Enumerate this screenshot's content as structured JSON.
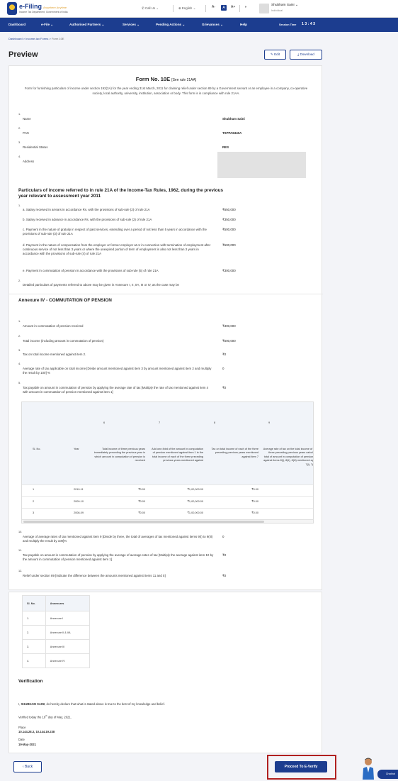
{
  "header": {
    "logo_title": "e-Filing",
    "logo_subtitle": "Anywhere Anytime",
    "logo_tagline": "Income Tax Department, Government of India",
    "call_us": "Call Us",
    "language": "English",
    "a11y_small": "A-",
    "a11y_normal": "A",
    "a11y_large": "A+",
    "contrast": "◑",
    "user_name": "Shubham Saini",
    "user_role": "Individual"
  },
  "nav": {
    "items": [
      "Dashboard",
      "e-File",
      "Authorised Partners",
      "Services",
      "Pending Actions",
      "Grievances",
      "Help"
    ],
    "session_label": "Session Time",
    "session_time": "1 3 : 4 3"
  },
  "breadcrumb": [
    "Dashboard",
    "Income-tax Forms",
    "Form 10E"
  ],
  "page": {
    "title": "Preview",
    "edit_label": "Edit",
    "download_label": "Download"
  },
  "form": {
    "title": "Form No. 10E",
    "rule_ref": "[See rule 21AA]",
    "description": "Form for furnishing particulars of income under section 192(2A) for the year ending 31st March, 2011 for claiming relief under section 89 by a Government servant or an employee in a company, co-operative society, local authority, university, institution, association or body. This form is in compliance with rule 21AA.",
    "personal": [
      {
        "num": "1.",
        "label": "Name",
        "value": "Shubham Saini"
      },
      {
        "num": "2.",
        "label": "PAN",
        "value": "TSPPA6340A"
      },
      {
        "num": "3.",
        "label": "Residential Status",
        "value": "RES"
      },
      {
        "num": "4.",
        "label": "Address",
        "value": ""
      }
    ],
    "particulars_heading": "Particulars of income referred to in rule 21A of the Income-Tax Rules, 1962, during the previous year relevant to assessment year 2011",
    "particulars_num": "1.",
    "particulars": [
      {
        "label": "a. Salary received in arrears in accordance Rs. with the provisions of sub-rule (2) of rule 21A",
        "value": "₹650,000"
      },
      {
        "label": "b. Salary received in advance in accordance Rs. with the provisions of sub-rule (2) of rule 21A",
        "value": "₹350,000"
      },
      {
        "label": "c. Payment in the nature of gratuity in respect of past services, extending over a period of not less than 5 years in accordance with the provisions of sub-rule (3) of rule 21A",
        "value": "₹500,000"
      },
      {
        "label": "d. Payment in the nature of compensation from the employer or former employer at or in connection with termination of employment after continuous service of not less than 3 years or where the unexpired portion of term of employment is also not less than 3 years in accordance with the provisions of sub-rule (4) of rule 21A",
        "value": "₹500,000"
      },
      {
        "label": "e. Payment in commutation of pension in accordance with the provisions of sub-rule (5) of rule 21A",
        "value": "₹300,000"
      }
    ],
    "item2_num": "2.",
    "item2_label": "Detailed particulars of payments referred to above may be given in Annexure I, II, IIA, III or IV, as the case may be"
  },
  "annexure4": {
    "heading": "Annexure IV - COMMUTATION OF PENSION",
    "items": [
      {
        "num": "1.",
        "label": "Amount in commutation of pension received",
        "value": "₹300,000"
      },
      {
        "num": "2.",
        "label": "Total income (including amount in commutation of pension)",
        "value": "₹600,000"
      },
      {
        "num": "3.",
        "label": "Tax on total income mentioned against item 2.",
        "value": "₹0"
      },
      {
        "num": "4.",
        "label": "Average rate of tax applicable on total income [Divide amount mentioned against item 3 by amount mentioned against item 2 and multiply the result by 100] %",
        "value": "0"
      },
      {
        "num": "5.",
        "label": "Tax payable on amount in commutation of pension by applying the average rate of tax [Multiply the rate of tax mentioned against item 4 with amount in commutation of pension mentioned against item 1]",
        "value": "₹0"
      }
    ],
    "table": {
      "col_numbers": [
        "6",
        "7",
        "8",
        "9"
      ],
      "headers": [
        "Sl. No.",
        "Year",
        "Total income of three previous years immediately preceding the previous year in which amount in computation of pension is received",
        "Add one-third of the amount in computation of pension mentioned against item 1 in the total income of each of the three preceding previous years mentioned against",
        "Tax on total income of each of the three preceding previous years mentioned against item 7",
        "Average rate of tax on the total income of each of the three preceding previous years calculated on the total of amount in computation of pension mentioned against items 8(i), 8(ii), 8(iii) mentioned against items 7(i), 7(ii) and 7(iii)"
      ],
      "rows": [
        [
          "1",
          "2010-11",
          "₹0.00",
          "₹1,00,000.00",
          "₹0.00"
        ],
        [
          "2",
          "2009-10",
          "₹0.00",
          "₹1,00,000.00",
          "₹0.00"
        ],
        [
          "3",
          "2008-09",
          "₹0.00",
          "₹1,00,000.00",
          "₹0.00"
        ]
      ]
    },
    "items_after": [
      {
        "num": "10.",
        "label": "Average of average rates of tax mentioned against item 9 [Divide by three, the total of averages of tax mentioned against items 9(i) to 9(iii) and multiply the result by 100]%",
        "value": "0"
      },
      {
        "num": "11.",
        "label": "Tax payable on amount in commutation of pension by applying the average of average rates of tax [Multiply the average against item 10 by the amount in commutation of pension mentioned against item 1]",
        "value": "₹0"
      },
      {
        "num": "12.",
        "label": "Relief under section 89 [Indicate the difference between the amounts mentioned against items 11 and 5]",
        "value": "₹0"
      }
    ]
  },
  "annexures": {
    "headers": [
      "Sl. No.",
      "Annexures"
    ],
    "rows": [
      [
        "1.",
        "Annexure I"
      ],
      [
        "2.",
        "Annexure II & IIA"
      ],
      [
        "3.",
        "Annexure III"
      ],
      [
        "4.",
        "Annexure IV"
      ]
    ]
  },
  "verification": {
    "heading": "Verification",
    "declaration_prefix": "I,",
    "declarant": "SHUBHAM SAINI",
    "declaration_suffix": ", do hereby declare that what is stated above is true to the best of my knowledge and belief.",
    "verified_prefix": "Verified today the 19",
    "verified_sup": "th",
    "verified_suffix": " day of May, 2021.",
    "place_label": "Place",
    "place_value": "10.144.28.3, 10.144.19.238",
    "date_label": "Date",
    "date_value": "19-May-2021"
  },
  "footer": {
    "back_label": "Back",
    "proceed_label": "Proceed To E-Verify",
    "chatbot_label": "Chatbot"
  },
  "colors": {
    "brand_blue": "#1c3d8f",
    "highlight_red": "#b02020"
  }
}
